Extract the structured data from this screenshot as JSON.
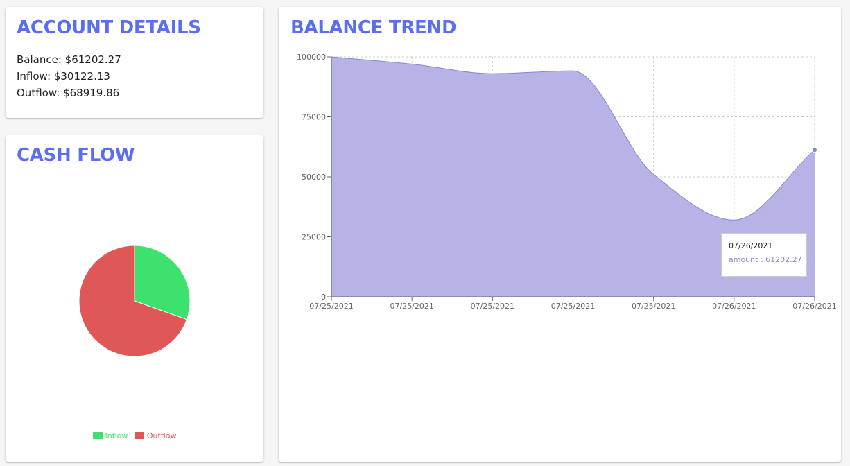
{
  "account_details": {
    "title": "ACCOUNT DETAILS",
    "balance_line": "Balance: $61202.27",
    "inflow_line": "Inflow: $30122.13",
    "outflow_line": "Outflow: $68919.86"
  },
  "cash_flow": {
    "title": "CASH FLOW",
    "legend": [
      {
        "label": "Inflow",
        "color": "#3DE26E"
      },
      {
        "label": "Outflow",
        "color": "#E05757"
      }
    ]
  },
  "balance_trend": {
    "title": "BALANCE TREND",
    "tooltip": {
      "date": "07/26/2021",
      "series_label": "amount",
      "value": "61202.27"
    }
  },
  "colors": {
    "title": "#5B6EF0",
    "area_fill": "#B6B3E6",
    "area_stroke": "#8884d8",
    "inflow": "#3DE26E",
    "outflow": "#E05757",
    "grid": "#cccccc"
  },
  "chart_data": [
    {
      "type": "pie",
      "categories": [
        "Inflow",
        "Outflow"
      ],
      "values": [
        30122.13,
        68919.86
      ],
      "colors": [
        "#3DE26E",
        "#E05757"
      ],
      "legend_position": "bottom"
    },
    {
      "type": "area",
      "x": [
        "07/25/2021",
        "07/25/2021",
        "07/25/2021",
        "07/25/2021",
        "07/25/2021",
        "07/26/2021",
        "07/26/2021"
      ],
      "series": [
        {
          "name": "amount",
          "values": [
            100000,
            97000,
            93000,
            94200,
            51000,
            32000,
            61202.27
          ]
        }
      ],
      "ylim": [
        0,
        100000
      ],
      "yticks": [
        0,
        25000,
        50000,
        75000,
        100000
      ],
      "grid": true
    }
  ]
}
